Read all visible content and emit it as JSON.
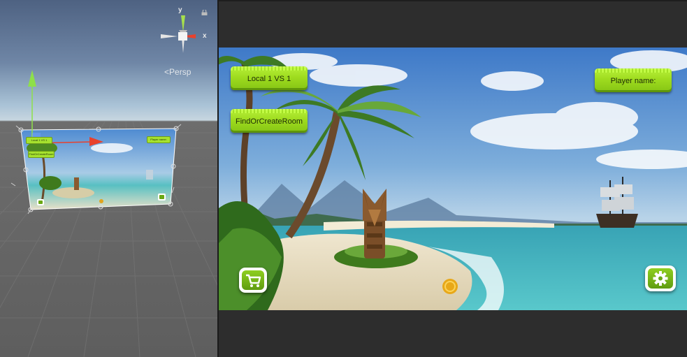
{
  "scene_view": {
    "gizmo": {
      "axis_y": "y",
      "axis_x": "x",
      "projection_label": "Persp",
      "icons": [
        "lock-icon",
        "axis-gizmo-icon",
        "move-tool-icon"
      ]
    },
    "canvas_preview": {
      "buttons": [
        "Local 1 VS 1",
        "FindOrCreateRoom",
        "Player name:"
      ]
    }
  },
  "game_view": {
    "buttons": {
      "local_vs": "Local 1 VS 1",
      "find_room": "FindOrCreateRoom",
      "player_name": "Player name:"
    },
    "icons": {
      "shop": "shopping-cart-icon",
      "settings": "gear-icon",
      "coin": "coin-icon"
    }
  },
  "colors": {
    "button_green": "#9fdc1f",
    "editor_dark": "#2d2d2d",
    "axis_red": "#e8412c",
    "axis_green": "#8ee04a"
  }
}
